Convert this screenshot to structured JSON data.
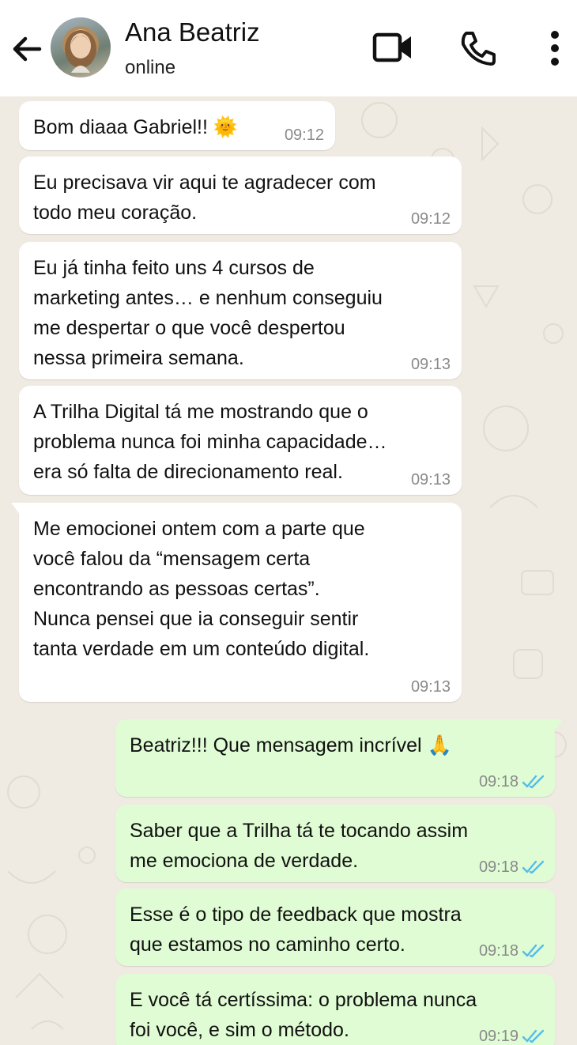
{
  "header": {
    "contact_name": "Ana Beatriz",
    "status": "online",
    "icons": [
      "arrow-left-icon",
      "avatar",
      "video-camera-icon",
      "phone-icon",
      "more-vertical-icon"
    ]
  },
  "messages": [
    {
      "direction": "incoming",
      "text": "Bom diaaa Gabriel!! 🌞",
      "time": "09:12"
    },
    {
      "direction": "incoming",
      "text": "Eu precisava vir aqui te agradecer com\ntodo meu coração.",
      "time": "09:12"
    },
    {
      "direction": "incoming",
      "text": "Eu já tinha feito uns 4 cursos de\nmarketing antes… e nenhum conseguiu\nme despertar o que você despertou\nnessa primeira semana.",
      "time": "09:13"
    },
    {
      "direction": "incoming",
      "text": "A Trilha Digital tá me mostrando que o\nproblema nunca foi minha capacidade…\nera só falta de direcionamento real.",
      "time": "09:13"
    },
    {
      "direction": "incoming",
      "text": "Me emocionei ontem com a parte que\nvocê falou da “mensagem certa\nencontrando as pessoas certas”.\nNunca pensei que ia conseguir sentir\ntanta verdade em um conteúdo digital.",
      "time": "09:13"
    },
    {
      "direction": "outgoing",
      "text": "Beatriz!!! Que mensagem incrível 🙏",
      "time": "09:18",
      "status": "read"
    },
    {
      "direction": "outgoing",
      "text": "Saber que a Trilha tá te tocando assim\nme emociona de verdade.",
      "time": "09:18",
      "status": "read"
    },
    {
      "direction": "outgoing",
      "text": "Esse é o tipo de feedback que mostra\nque estamos no caminho certo.",
      "time": "09:18",
      "status": "read"
    },
    {
      "direction": "outgoing",
      "text": "E você tá certíssima: o problema nunca\nfoi você, e sim o método.",
      "time": "09:19",
      "status": "read"
    }
  ],
  "colors": {
    "chat_background": "#efeae2",
    "incoming_bubble": "#ffffff",
    "outgoing_bubble": "#e0fcd4",
    "read_ticks": "#53bdeb"
  }
}
